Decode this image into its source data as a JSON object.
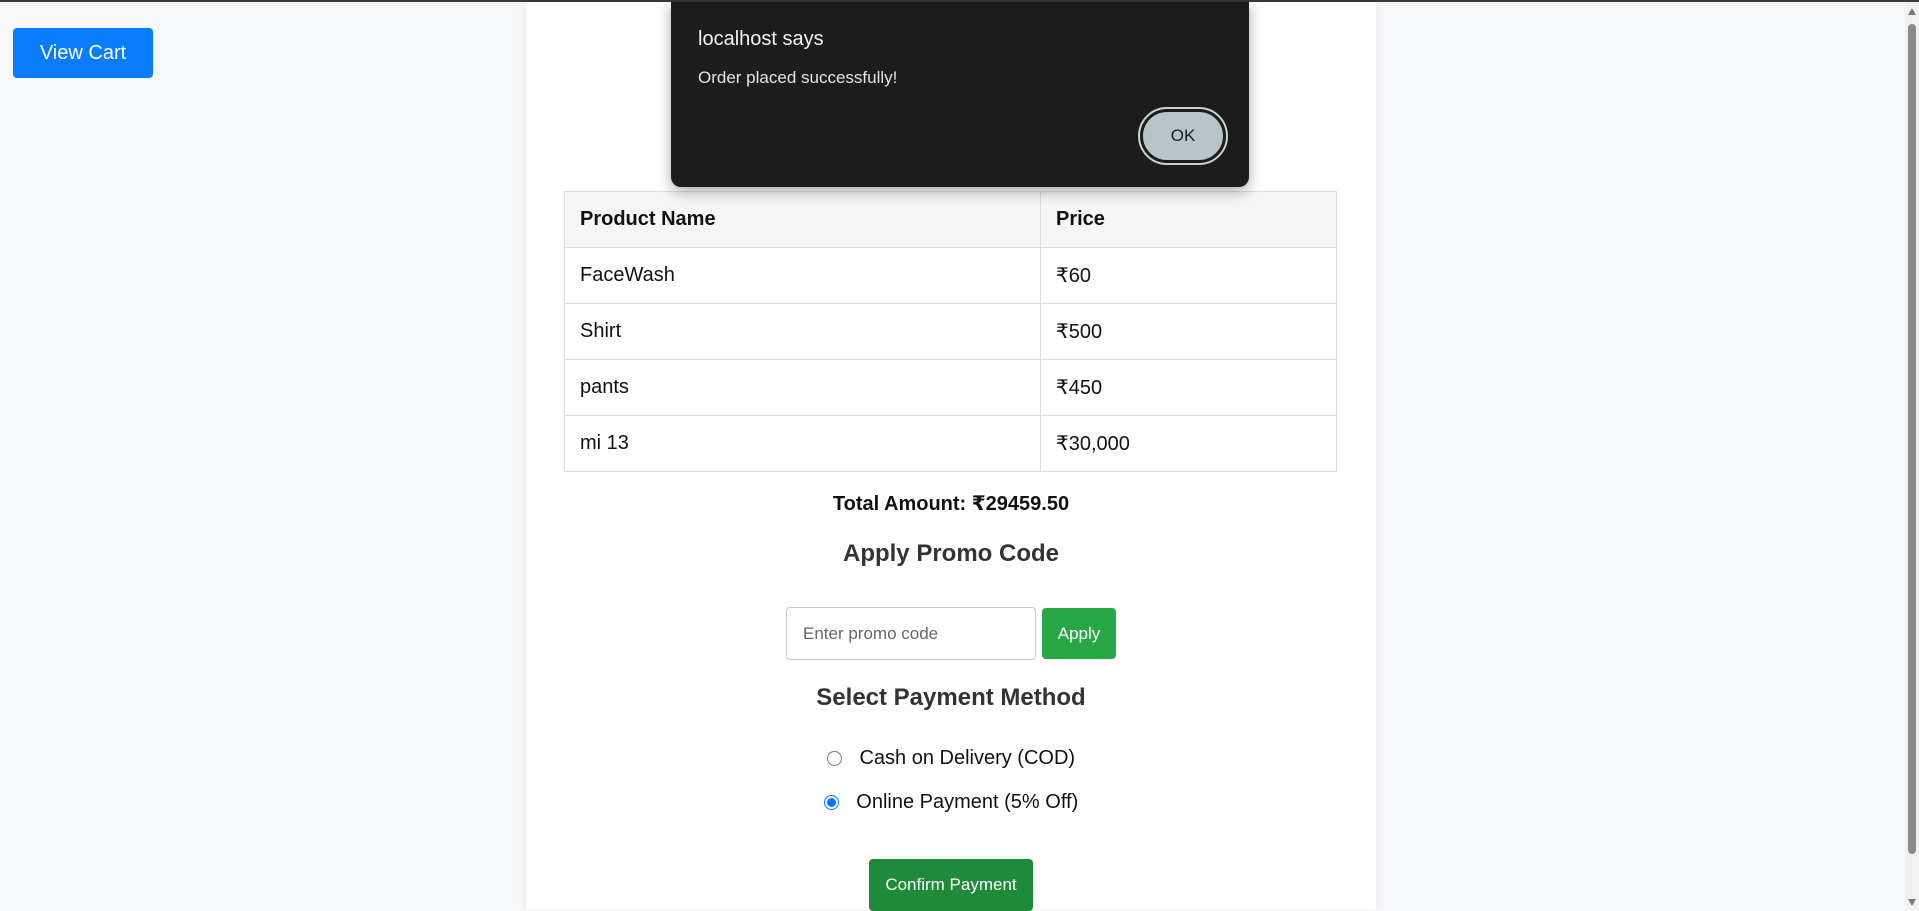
{
  "header": {
    "view_cart_label": "View Cart"
  },
  "alert": {
    "title": "localhost says",
    "message": "Order placed successfully!",
    "ok_label": "OK"
  },
  "cart": {
    "columns": [
      "Product Name",
      "Price"
    ],
    "rows": [
      {
        "name": "FaceWash",
        "price": "₹60"
      },
      {
        "name": "Shirt",
        "price": "₹500"
      },
      {
        "name": "pants",
        "price": "₹450"
      },
      {
        "name": "mi 13",
        "price": "₹30,000"
      }
    ],
    "total_text": "Total Amount: ₹29459.50"
  },
  "promo": {
    "heading": "Apply Promo Code",
    "placeholder": "Enter promo code",
    "apply_label": "Apply"
  },
  "payment": {
    "heading": "Select Payment Method",
    "options": [
      {
        "label": "Cash on Delivery (COD)",
        "selected": false
      },
      {
        "label": "Online Payment (5% Off)",
        "selected": true
      }
    ],
    "confirm_label": "Confirm Payment"
  },
  "colors": {
    "primary": "#0a7cff",
    "apply": "#28a745",
    "confirm": "#1f8b3a",
    "alert_bg": "#1b1c1b"
  }
}
